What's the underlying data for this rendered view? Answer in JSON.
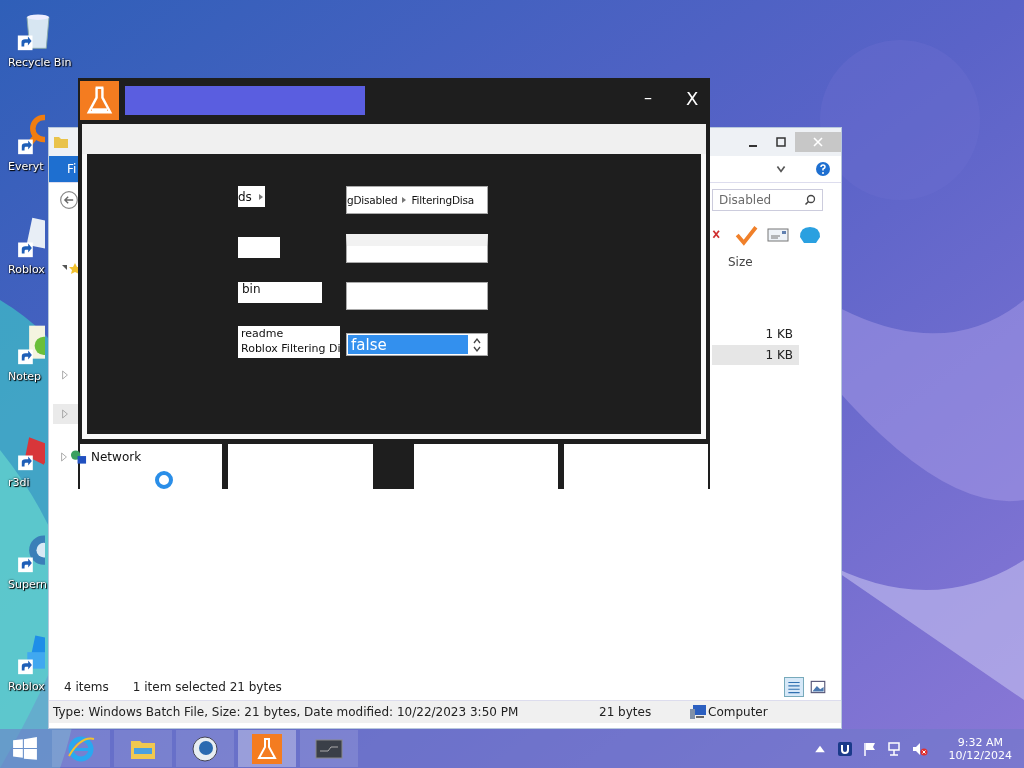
{
  "desktop_icons": [
    {
      "label": "Recycle Bin",
      "kind": "bin"
    },
    {
      "label": "Everyt",
      "kind": "ring"
    },
    {
      "label": "Roblox",
      "kind": "tile"
    },
    {
      "label": "Notep",
      "kind": "notepad"
    },
    {
      "label": "r3di",
      "kind": "red"
    },
    {
      "label": "Supern",
      "kind": "sphere"
    },
    {
      "label": "Roblox",
      "kind": "studio"
    }
  ],
  "explorer": {
    "ribbon_tab": "Fi",
    "search": {
      "placeholder": "Disabled"
    },
    "column": "Size",
    "rows": [
      {
        "size": "1 KB",
        "selected": false
      },
      {
        "size": "1 KB",
        "selected": true
      }
    ],
    "nav_item": "Network",
    "status": {
      "items": "4 items",
      "selection": "1 item selected  21 bytes"
    },
    "details": {
      "text": "Type: Windows Batch File, Size: 21 bytes, Date modified: 10/22/2023 3:50 PM",
      "size": "21 bytes",
      "location": "Computer"
    }
  },
  "app_window": {
    "minimize": "–",
    "close": "X",
    "breadcrumb_left": "ds",
    "breadcrumb": [
      "gDisabled",
      "FilteringDisa"
    ],
    "name_field": {
      "value": "bin"
    },
    "list": [
      "readme",
      "Roblox Filtering Di"
    ],
    "spinner": {
      "value": "false",
      "selected": true
    }
  },
  "taskbar": {
    "apps": [
      {
        "kind": "ie",
        "selected": false
      },
      {
        "kind": "folder",
        "selected": false
      },
      {
        "kind": "globe",
        "selected": false
      },
      {
        "kind": "flask",
        "selected": true
      },
      {
        "kind": "window",
        "selected": false
      }
    ],
    "time": "9:32 AM",
    "date": "10/12/2024"
  }
}
